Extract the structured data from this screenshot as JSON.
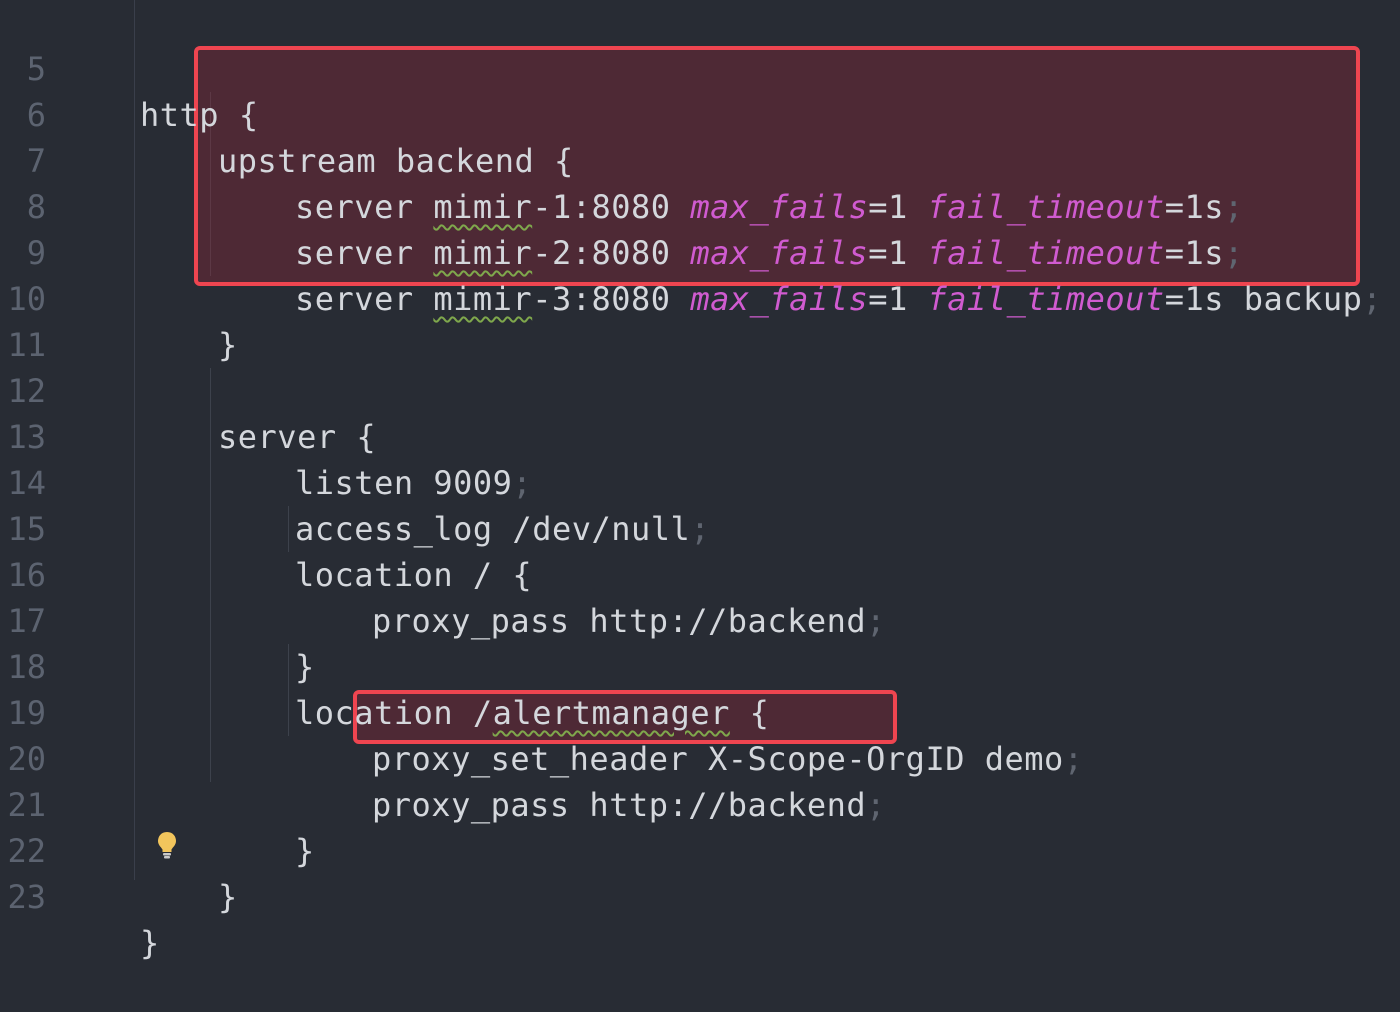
{
  "editor": {
    "lines": [
      {
        "number": "5",
        "code": "http {"
      },
      {
        "number": "6",
        "code": "upstream backend {"
      },
      {
        "number": "7",
        "keyword": "server",
        "host": "mimir",
        "host_rest": "-1:8080",
        "p1": "max_fails",
        "v1": "=1",
        "p2": "fail_timeout",
        "v2": "=1s",
        "tail": "",
        "semi": ";"
      },
      {
        "number": "8",
        "keyword": "server",
        "host": "mimir",
        "host_rest": "-2:8080",
        "p1": "max_fails",
        "v1": "=1",
        "p2": "fail_timeout",
        "v2": "=1s",
        "tail": "",
        "semi": ";"
      },
      {
        "number": "9",
        "keyword": "server",
        "host": "mimir",
        "host_rest": "-3:8080",
        "p1": "max_fails",
        "v1": "=1",
        "p2": "fail_timeout",
        "v2": "=1s",
        "tail": " backup",
        "semi": ";"
      },
      {
        "number": "10",
        "code": "}"
      },
      {
        "number": "11",
        "code": ""
      },
      {
        "number": "12",
        "code": "server {"
      },
      {
        "number": "13",
        "code": "listen 9009",
        "semi": ";"
      },
      {
        "number": "14",
        "code": "access_log /dev/null",
        "semi": ";"
      },
      {
        "number": "15",
        "code": "location / {"
      },
      {
        "number": "16",
        "code": "proxy_pass http://backend",
        "semi": ";"
      },
      {
        "number": "17",
        "code": "}"
      },
      {
        "number": "18",
        "pre": "location /",
        "squig": "alertmanager",
        "post": " {"
      },
      {
        "number": "19",
        "code": "proxy_set_header X-Scope-OrgID demo",
        "semi": ";"
      },
      {
        "number": "20",
        "code": "proxy_pass http://backend",
        "semi": ";"
      },
      {
        "number": "21",
        "code": "}"
      },
      {
        "number": "22",
        "code": "}"
      },
      {
        "number": "23",
        "code": "}"
      }
    ]
  },
  "colors": {
    "background": "#282c34",
    "highlight_border": "#ef4550",
    "param_italic": "#d05bd0",
    "squiggle": "#7fa84c"
  },
  "icons": [
    "lightbulb-icon"
  ]
}
